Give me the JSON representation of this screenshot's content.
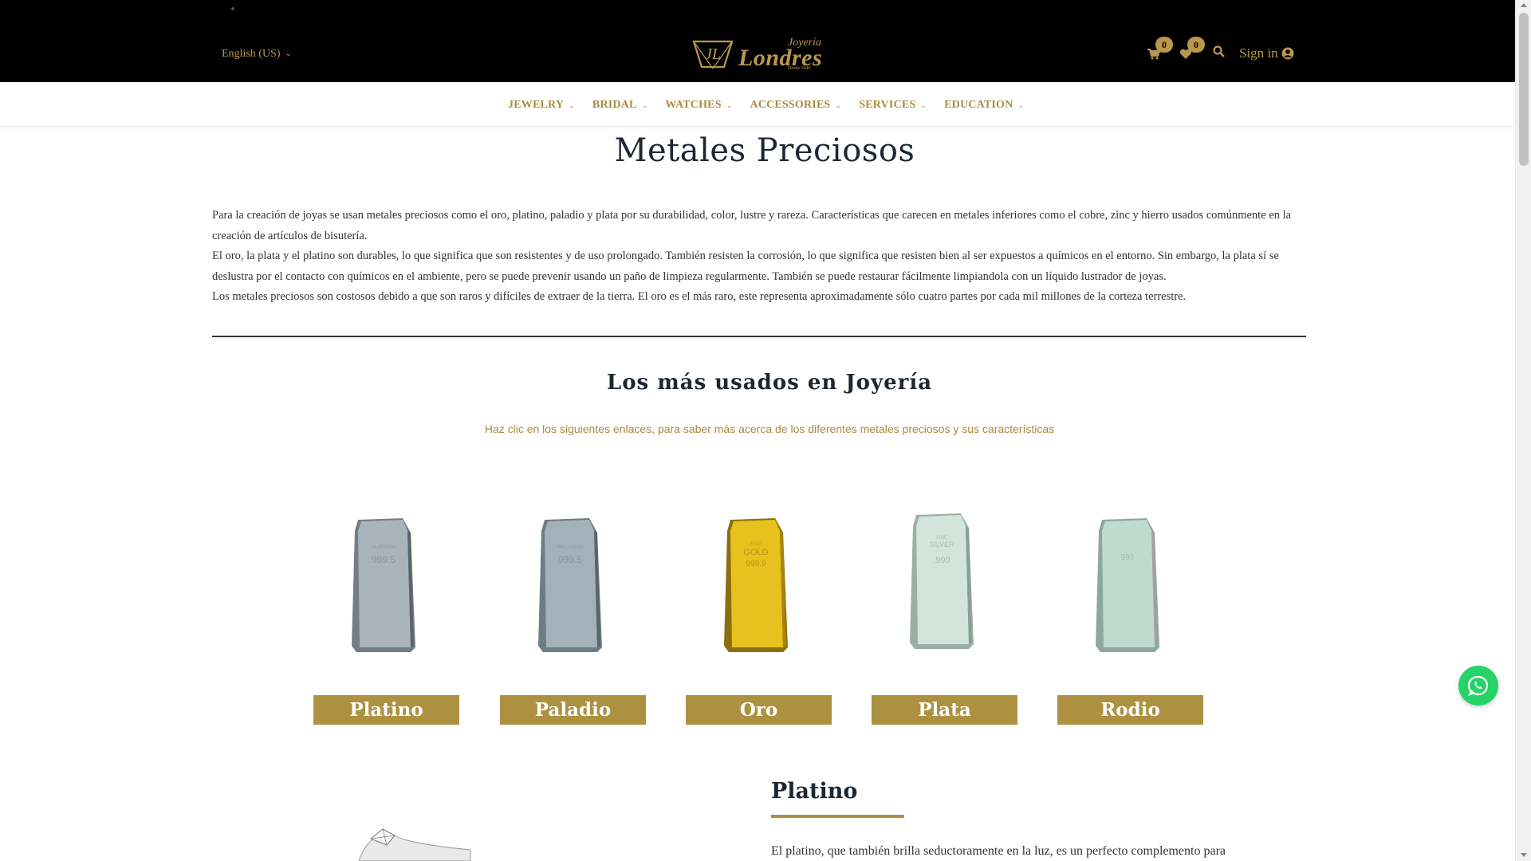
{
  "header": {
    "language": "English (US)",
    "logo": {
      "initials": "JL",
      "small": "Joyería",
      "big": "Londres",
      "since": "Desde 1940"
    },
    "cart_count": "0",
    "wishlist_count": "0",
    "signin_label": "Sign in"
  },
  "nav": {
    "items": [
      {
        "label": "JEWELRY"
      },
      {
        "label": "BRIDAL"
      },
      {
        "label": "WATCHES"
      },
      {
        "label": "ACCESSORIES"
      },
      {
        "label": "SERVICES"
      },
      {
        "label": "EDUCATION"
      }
    ]
  },
  "main": {
    "title": "Metales Preciosos",
    "intro": [
      "Para la creación de joyas se usan metales preciosos como el oro, platino, paladio y plata por su durabilidad, color, lustre y rareza. Características que carecen en metales inferiores como el cobre, zinc y hierro usados comúnmente en la creación de artículos de bisutería.",
      "El oro, la plata y el platino son durables, lo que significa que son resistentes y de uso prolongado. También resisten la corrosión, lo que significa que resisten bien al ser expuestos a químicos en el entorno. Sin embargo, la plata sí se deslustra por el contacto con químicos en el ambiente, pero se puede prevenir usando un paño de limpieza regularmente. También se puede restaurar fácilmente limpiandola con un líquido lustrador de joyas.",
      "Los metales preciosos son costosos debido a que son raros y difíciles de extraer de la tierra. El oro es el más raro, este representa aproximadamente sólo cuatro partes por cada mil millones de la corteza terrestre."
    ],
    "subtitle": "Los más usados en Joyería",
    "instruction": "Haz clic en los siguientes enlaces, para saber más acerca de los diferentes metales preciosos y sus características",
    "metals": [
      {
        "label": "Platino",
        "stamp": [
          "PLATINUM",
          "999.5"
        ],
        "color": "#a7b1b8"
      },
      {
        "label": "Paladio",
        "stamp": [
          "PALLADIUM",
          "999.5"
        ],
        "color": "#9fb0b5"
      },
      {
        "label": "Oro",
        "stamp": [
          "FINE",
          "GOLD",
          "999.9"
        ],
        "color": "#e2be22"
      },
      {
        "label": "Plata",
        "stamp": [
          "FINE",
          "SILVER",
          ".999"
        ],
        "color": "#cfe2da"
      },
      {
        "label": "Rodio",
        "stamp": [
          "999"
        ],
        "color": "#bcd8cc"
      }
    ],
    "section": {
      "title": "Platino",
      "text": "El platino, que también brilla seductoramente en la luz, es un perfecto complemento para"
    }
  },
  "colors": {
    "gold_accent": "#ad9140",
    "topbar": "#000000",
    "whatsapp": "#25d366"
  }
}
